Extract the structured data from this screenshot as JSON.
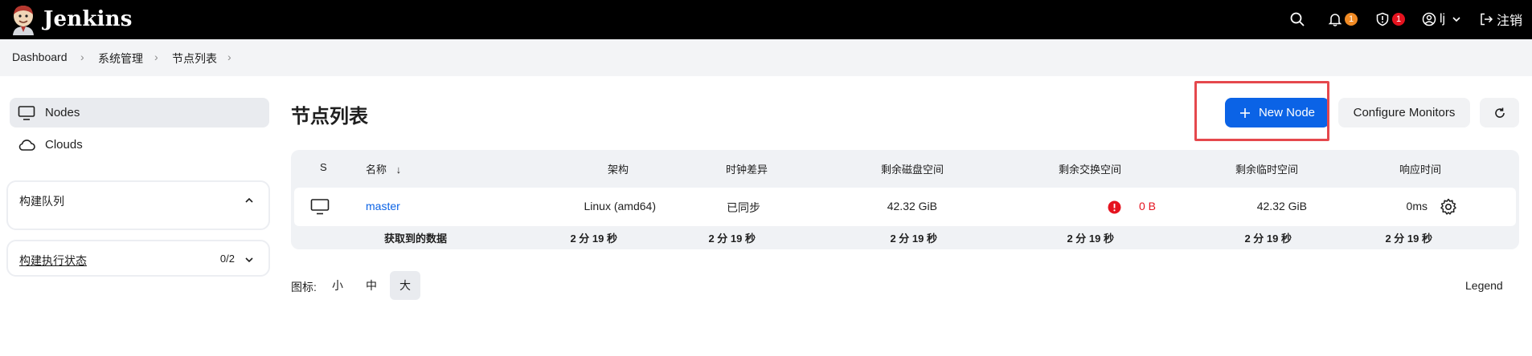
{
  "header": {
    "app_name": "Jenkins",
    "notifications_count": "1",
    "security_count": "1",
    "user_name": "lj",
    "logout_label": "注销",
    "colors": {
      "badge_notifications": "#f08a24",
      "badge_security": "#e5131f"
    }
  },
  "breadcrumb": {
    "items": [
      "Dashboard",
      "系统管理",
      "节点列表"
    ]
  },
  "sidebar": {
    "items": [
      {
        "label": "Nodes",
        "icon": "monitor-icon"
      },
      {
        "label": "Clouds",
        "icon": "cloud-icon"
      }
    ],
    "build_queue": {
      "title": "构建队列"
    },
    "executor_status": {
      "title": "构建执行状态",
      "count": "0/2"
    }
  },
  "main": {
    "title": "节点列表",
    "new_node_label": "New Node",
    "configure_monitors_label": "Configure Monitors",
    "columns": [
      "S",
      "名称",
      "架构",
      "时钟差异",
      "剩余磁盘空间",
      "剩余交换空间",
      "剩余临时空间",
      "响应时间"
    ],
    "sort_indicator": "↓",
    "rows": [
      {
        "name": "master",
        "architecture": "Linux (amd64)",
        "clock_diff": "已同步",
        "free_disk": "42.32 GiB",
        "free_swap": "0 B",
        "free_temp": "42.32 GiB",
        "response_time": "0ms"
      }
    ],
    "footer": {
      "label": "获取到的数据",
      "values": [
        "2 分 19 秒",
        "2 分 19 秒",
        "2 分 19 秒",
        "2 分 19 秒",
        "2 分 19 秒",
        "2 分 19 秒"
      ]
    },
    "icon_size": {
      "label": "图标:",
      "options": [
        "小",
        "中",
        "大"
      ],
      "selected": "大"
    },
    "legend_label": "Legend",
    "colors": {
      "primary": "#0b63e6",
      "danger": "#e5131f"
    }
  }
}
